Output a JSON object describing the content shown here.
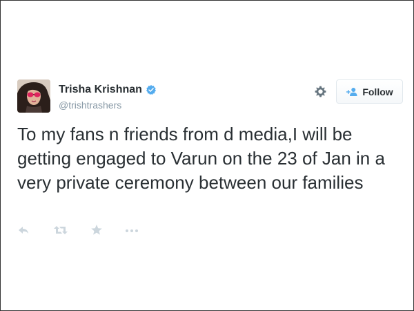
{
  "tweet": {
    "author": {
      "display_name": "Trisha Krishnan",
      "handle": "@trishtrashers",
      "verified": true
    },
    "text": "To my fans n friends from d media,I will be getting engaged to Varun on the 23 of Jan in a very private ceremony between our families",
    "follow_button": {
      "label": "Follow",
      "icon": "add-user-icon"
    },
    "settings_icon": "gear-icon",
    "actions": [
      "reply-icon",
      "retweet-icon",
      "favorite-icon",
      "more-icon"
    ]
  },
  "colors": {
    "text": "#292f33",
    "secondary_text": "#8899a6",
    "verified_badge": "#55acee",
    "action_icons": "#ccd6dd",
    "border": "#e1e8ed"
  }
}
